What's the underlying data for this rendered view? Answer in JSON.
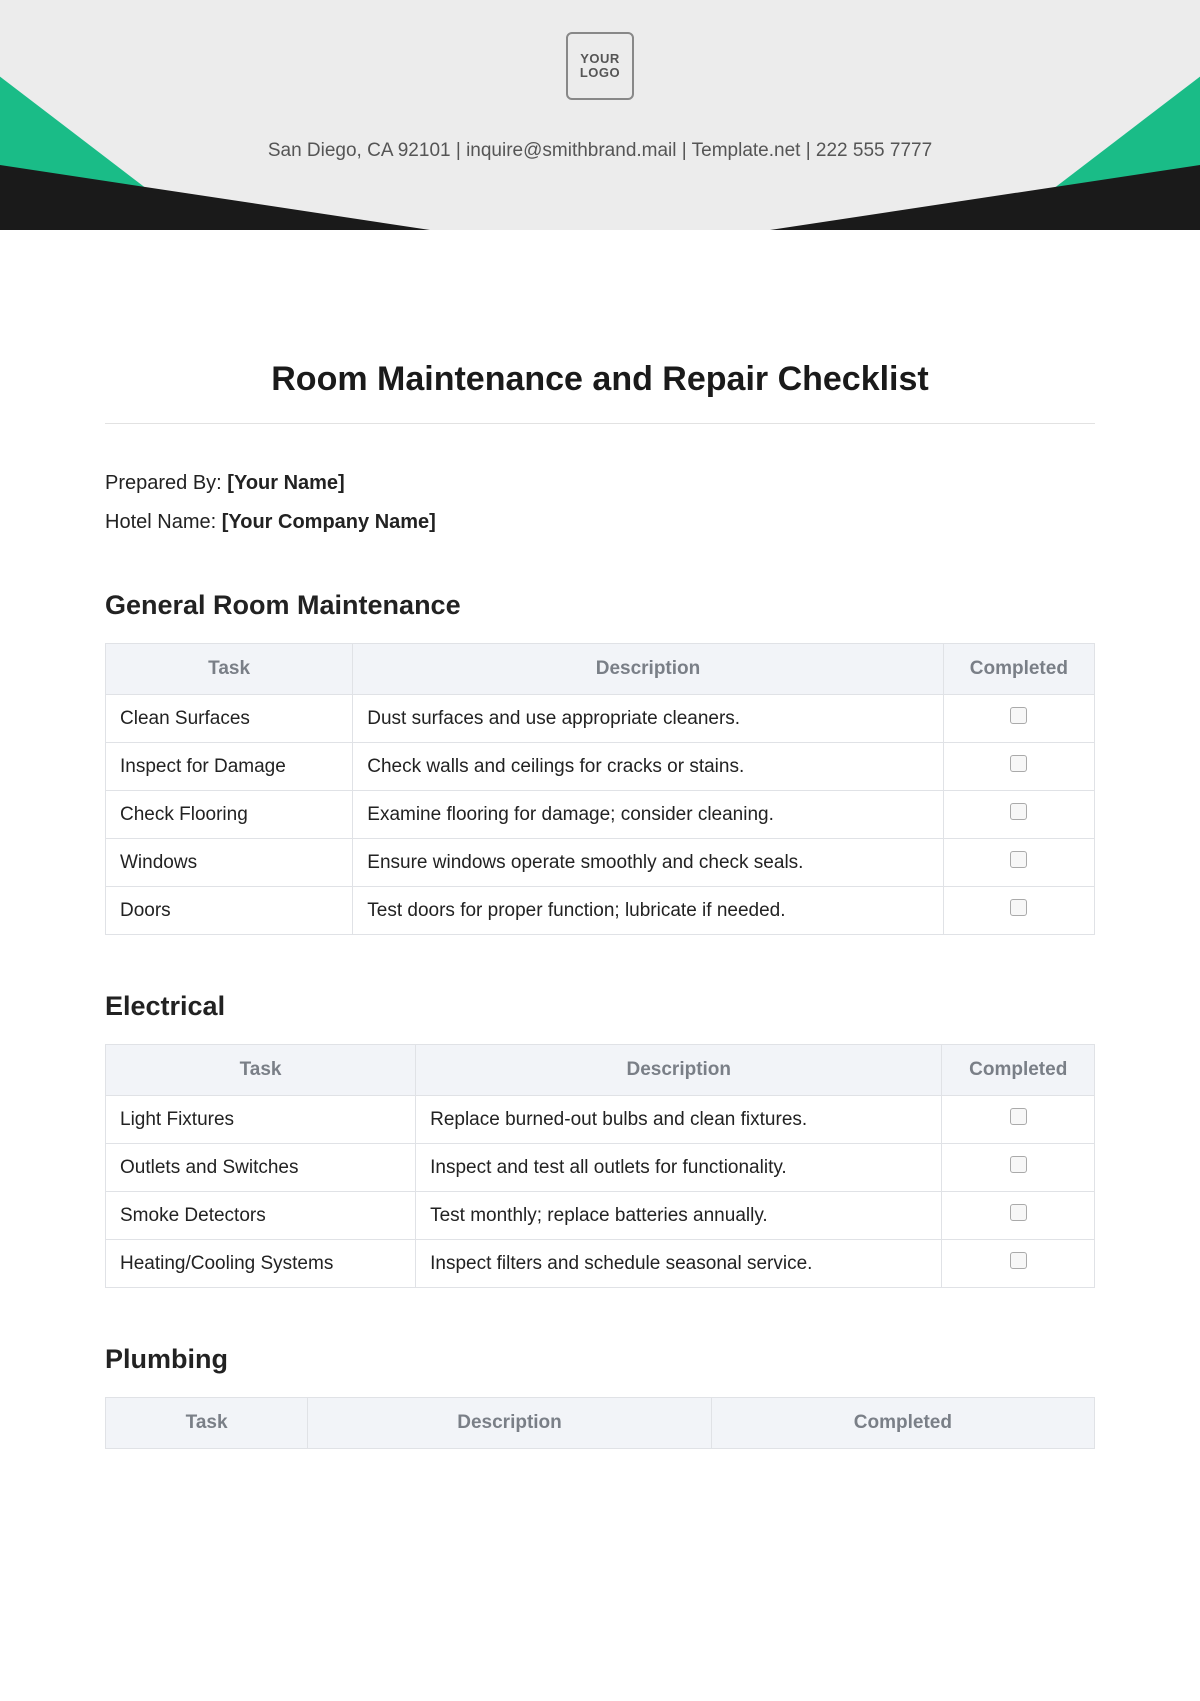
{
  "header": {
    "logo_text": "YOUR LOGO",
    "contact": "San Diego, CA 92101  |  inquire@smithbrand.mail  | Template.net  |  222 555 7777"
  },
  "title": "Room Maintenance and Repair Checklist",
  "meta": {
    "preparedBy_label": "Prepared By: ",
    "preparedBy_placeholder": "[Your Name]",
    "hotel_label": "Hotel Name: ",
    "hotel_placeholder": "[Your Company Name]"
  },
  "columns": {
    "task": "Task",
    "description": "Description",
    "completed": "Completed"
  },
  "sections": [
    {
      "title": "General Room Maintenance",
      "rows": [
        {
          "task": "Clean Surfaces",
          "desc": "Dust surfaces and use appropriate cleaners."
        },
        {
          "task": "Inspect for Damage",
          "desc": "Check walls and ceilings for cracks or stains."
        },
        {
          "task": "Check Flooring",
          "desc": "Examine flooring for damage; consider cleaning."
        },
        {
          "task": "Windows",
          "desc": "Ensure windows operate smoothly and check seals."
        },
        {
          "task": "Doors",
          "desc": "Test doors for proper function; lubricate if needed."
        }
      ]
    },
    {
      "title": "Electrical",
      "rows": [
        {
          "task": "Light Fixtures",
          "desc": "Replace burned-out bulbs and clean fixtures."
        },
        {
          "task": "Outlets and Switches",
          "desc": "Inspect and test all outlets for functionality."
        },
        {
          "task": "Smoke Detectors",
          "desc": "Test monthly; replace batteries annually."
        },
        {
          "task": "Heating/Cooling Systems",
          "desc": "Inspect filters and schedule seasonal service."
        }
      ]
    },
    {
      "title": "Plumbing",
      "rows": []
    }
  ]
}
